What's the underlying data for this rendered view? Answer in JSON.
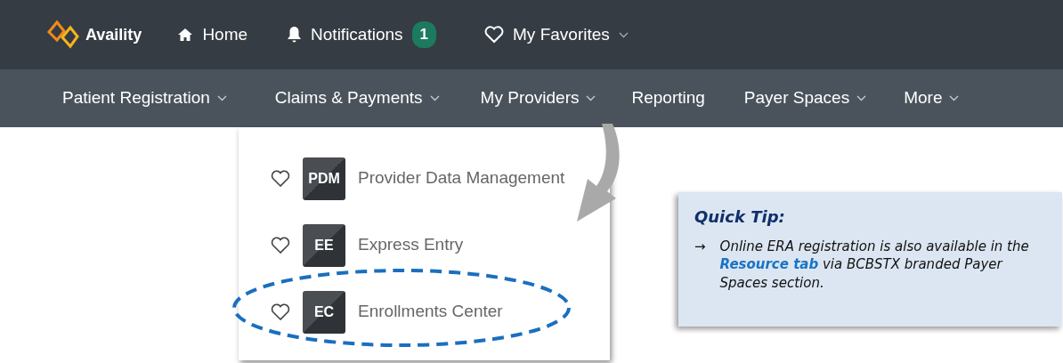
{
  "top_bar": {
    "logo": "Availity",
    "items": [
      {
        "kind": "home",
        "label": "Home"
      },
      {
        "kind": "notifications",
        "label": "Notifications",
        "count": "1"
      },
      {
        "kind": "favorites",
        "label": "My Favorites",
        "has_menu": true
      }
    ]
  },
  "main_nav": [
    {
      "label": "Patient Registration",
      "has_menu": true
    },
    {
      "label": "Claims & Payments",
      "has_menu": true
    },
    {
      "label": "My Providers",
      "has_menu": true,
      "expanded": true
    },
    {
      "label": "Reporting",
      "has_menu": false
    },
    {
      "label": "Payer Spaces",
      "has_menu": true
    },
    {
      "label": "More",
      "has_menu": true
    }
  ],
  "dropdown": [
    {
      "badge": "PDM",
      "label": "Provider Data Management",
      "favorite": false,
      "highlighted": false
    },
    {
      "badge": "EE",
      "label": "Express Entry",
      "favorite": false,
      "highlighted": false
    },
    {
      "badge": "EC",
      "label": "Enrollments Center",
      "favorite": false,
      "highlighted": true
    }
  ],
  "quick_tip": {
    "title": "Quick Tip:",
    "bullet": "→",
    "text": "Online ERA registration is also available in the **Resource tab** via BCBSTX branded Payer Spaces section."
  }
}
